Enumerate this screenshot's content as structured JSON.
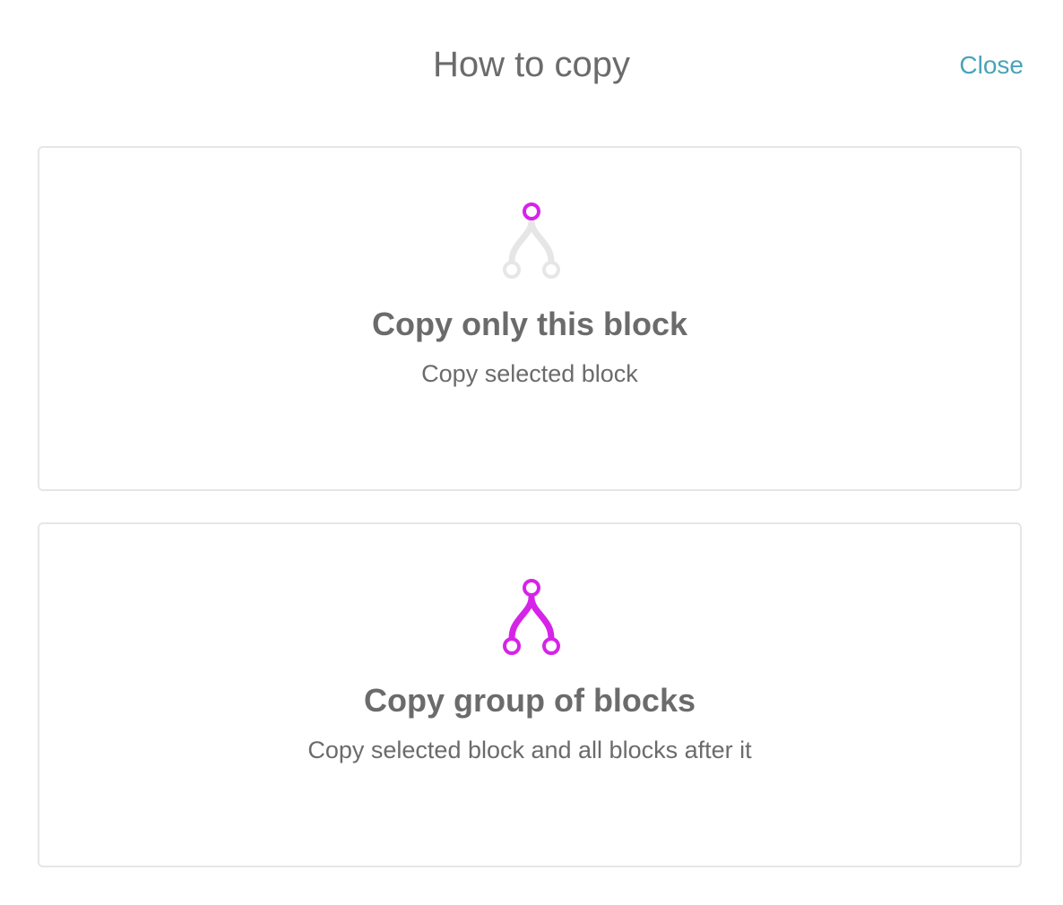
{
  "dialog": {
    "title": "How to copy",
    "close_label": "Close"
  },
  "options": [
    {
      "title": "Copy only this block",
      "description": "Copy selected block",
      "icon": "branch-icon-single"
    },
    {
      "title": "Copy group of blocks",
      "description": "Copy selected block and all blocks after it",
      "icon": "branch-icon-group"
    }
  ],
  "colors": {
    "accent": "#d623e8",
    "icon_inactive": "#e6e6e6",
    "link": "#4aa3b8",
    "text": "#6b6b6b",
    "border": "#e6e6e6"
  }
}
